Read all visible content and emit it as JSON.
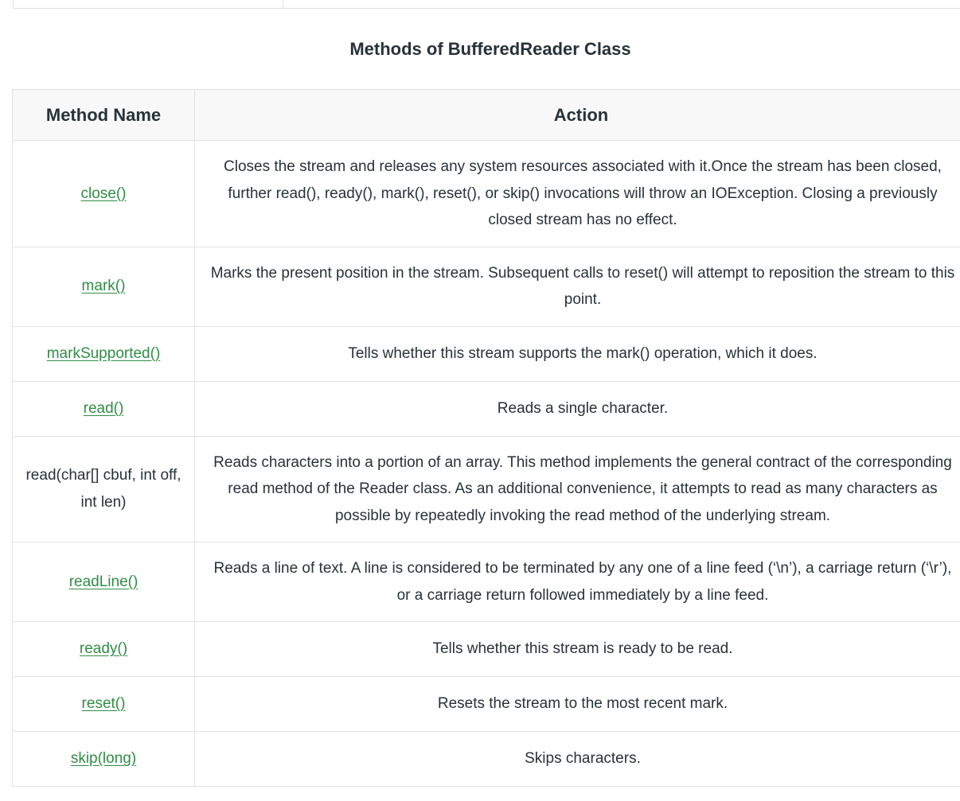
{
  "caption": "Methods of BufferedReader Class",
  "table": {
    "headers": [
      "Method Name",
      "Action"
    ],
    "rows": [
      {
        "method": "close()",
        "is_link": true,
        "action": "Closes the stream and releases any system resources associated with it.Once the stream has been closed, further read(), ready(), mark(), reset(), or skip() invocations will throw an IOException. Closing a previously closed stream has no effect."
      },
      {
        "method": "mark()",
        "is_link": true,
        "action": "Marks the present position in the stream. Subsequent calls to reset() will attempt to reposition the stream to this point."
      },
      {
        "method": "markSupported()",
        "is_link": true,
        "action": "Tells whether this stream supports the mark() operation, which it does."
      },
      {
        "method": "read()",
        "is_link": true,
        "action": "Reads a single character."
      },
      {
        "method": "read(char[] cbuf, int off, int len)",
        "is_link": false,
        "action": "Reads characters into a portion of an array. This method implements the general contract of the corresponding read method of the Reader class. As an additional convenience, it attempts to read as many characters as possible by repeatedly invoking the read method of the underlying stream."
      },
      {
        "method": "readLine()",
        "is_link": true,
        "action": "Reads a line of text. A line is considered to be terminated by any one of a line feed (‘\\n’), a carriage return (‘\\r’), or a carriage return followed immediately by a line feed."
      },
      {
        "method": "ready()",
        "is_link": true,
        "action": "Tells whether this stream is ready to be read."
      },
      {
        "method": "reset()",
        "is_link": true,
        "action": "Resets the stream to the most recent mark."
      },
      {
        "method": "skip(long)",
        "is_link": true,
        "action": "Skips characters."
      }
    ]
  },
  "colors": {
    "link": "#2f8d46",
    "text": "#273239",
    "header_bg": "#f8f8f8",
    "border": "#e2e2e2"
  }
}
